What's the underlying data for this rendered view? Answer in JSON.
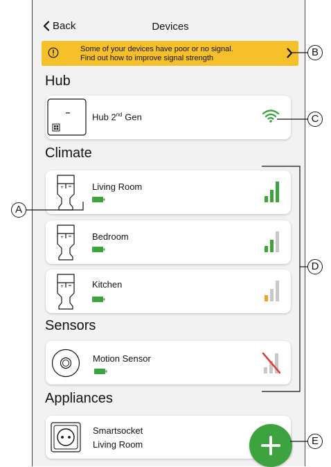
{
  "header": {
    "back_label": "Back",
    "title": "Devices"
  },
  "banner": {
    "line1": "Some of your devices have poor or no signal.",
    "line2": "Find out how to improve signal strength",
    "color": "#f6c02a"
  },
  "sections": {
    "hub": "Hub",
    "climate": "Climate",
    "sensors": "Sensors",
    "appliances": "Appliances"
  },
  "devices": {
    "hub": {
      "name": "Hub 2",
      "sup": "nd",
      "name_tail": " Gen",
      "icon": "hub-icon",
      "signal": "wifi-strong"
    },
    "living_room": {
      "name": "Living Room",
      "icon": "thermostat-valve-icon",
      "battery": "full",
      "signal_bars": 3
    },
    "bedroom": {
      "name": "Bedroom",
      "icon": "thermostat-valve-icon",
      "battery": "full",
      "signal_bars": 2
    },
    "kitchen": {
      "name": "Kitchen",
      "icon": "thermostat-valve-icon",
      "battery": "full",
      "signal_bars": 1
    },
    "motion": {
      "name": "Motion Sensor",
      "icon": "motion-sensor-icon",
      "battery": "full",
      "signal_bars": 0
    },
    "smartsocket": {
      "line1": "Smartsocket",
      "line2": "Living Room",
      "icon": "socket-icon"
    }
  },
  "fab": {
    "icon": "plus-icon",
    "color": "#3ca33f"
  },
  "annotations": {
    "a": "A",
    "b": "B",
    "c": "C",
    "d": "D",
    "e": "E"
  },
  "colors": {
    "green": "#3ca33f",
    "orange": "#f0a22a",
    "gray_bar": "#c8c8c8",
    "red": "#e23b3b"
  }
}
